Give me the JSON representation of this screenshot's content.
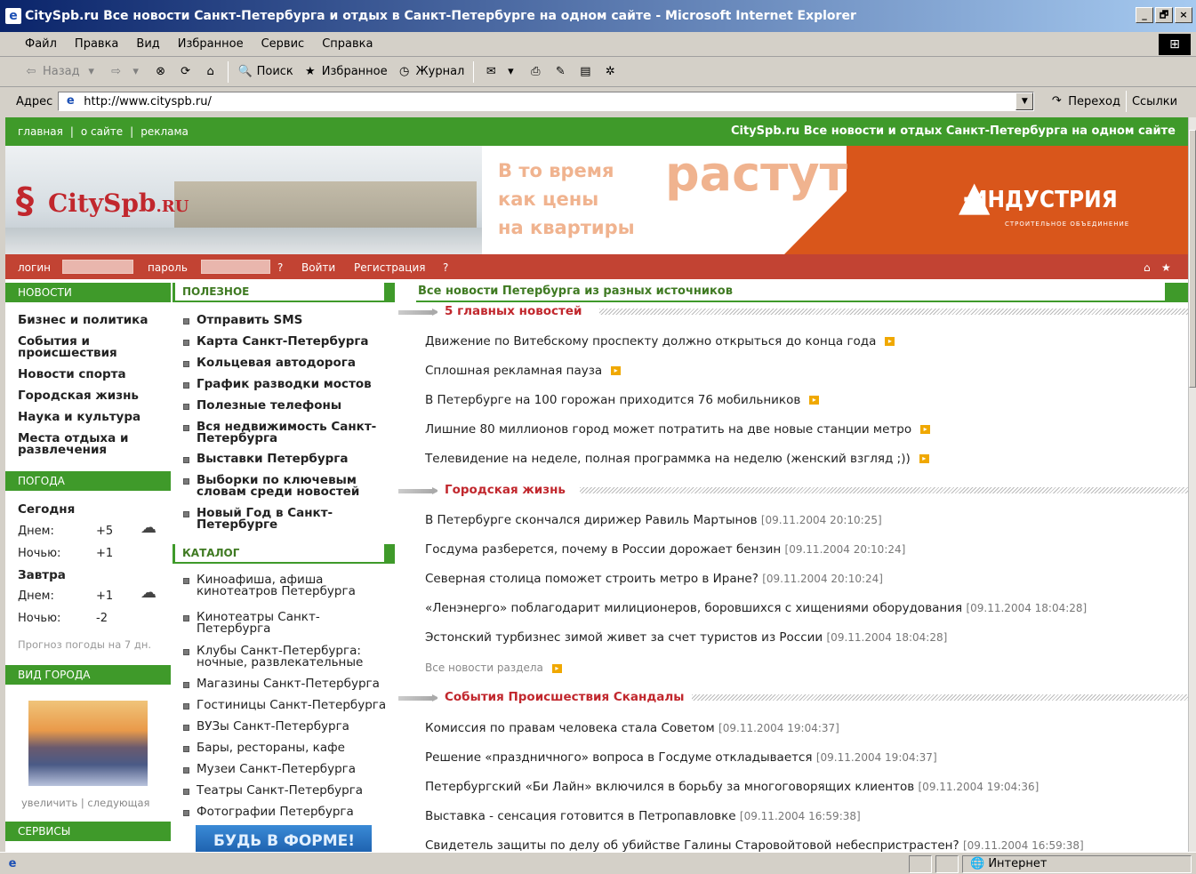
{
  "window": {
    "title": "CitySpb.ru Все новости Санкт-Петербурга и отдых в Санкт-Петербурге на одном сайте - Microsoft Internet Explorer",
    "min": "_",
    "max": "🗗",
    "close": "×"
  },
  "menu": [
    "Файл",
    "Правка",
    "Вид",
    "Избранное",
    "Сервис",
    "Справка"
  ],
  "toolbar": {
    "back": "Назад",
    "search": "Поиск",
    "favorites": "Избранное",
    "history": "Журнал"
  },
  "address": {
    "label": "Адрес",
    "url": "http://www.cityspb.ru/",
    "go": "Переход",
    "links": "Ссылки"
  },
  "site": {
    "topnav": {
      "links": [
        "главная",
        "о сайте",
        "реклама"
      ],
      "separator": "|",
      "tagline": "CitySpb.ru Все новости и отдых Санкт-Петербурга на одном сайте"
    },
    "logo": {
      "main": "CitySpb",
      "suffix": ".RU"
    },
    "ad": {
      "line1": "В то время",
      "line2": "как цены",
      "line3": "на квартиры",
      "big": "растут",
      "brand": "ИНДУСТРИЯ",
      "brand_sub": "СТРОИТЕЛЬНОЕ ОБЪЕДИНЕНИЕ"
    },
    "login": {
      "login_label": "логин",
      "password_label": "пароль",
      "q1": "?",
      "enter": "Войти",
      "register": "Регистрация",
      "q2": "?"
    },
    "left": {
      "news_head": "НОВОСТИ",
      "news_items": [
        "Бизнес и политика",
        "События и происшествия",
        "Новости спорта",
        "Городская жизнь",
        "Наука и культура",
        "Места отдыха и развлечения"
      ],
      "weather_head": "ПОГОДА",
      "today": "Сегодня",
      "tomorrow": "Завтра",
      "day": "Днем:",
      "night": "Ночью:",
      "today_day": "+5",
      "today_night": "+1",
      "tomorrow_day": "+1",
      "tomorrow_night": "-2",
      "forecast_link": "Прогноз погоды на 7 дн.",
      "city_head": "ВИД ГОРОДА",
      "enlarge": "увеличить",
      "next": "следующая",
      "services_head": "СЕРВИСЫ"
    },
    "mid": {
      "useful_head": "ПОЛЕЗНОЕ",
      "useful": [
        "Отправить SMS",
        "Карта Санкт-Петербурга",
        "Кольцевая автодорога",
        "График разводки мостов",
        "Полезные телефоны",
        "Вся недвижимость Санкт-Петербурга",
        "Выставки Петербурга",
        "Выборки по ключевым словам среди новостей",
        "Новый Год в Санкт-Петербурге"
      ],
      "catalog_head": "КАТАЛОГ",
      "catalog": [
        "Киноафиша, афиша кинотеатров Петербурга",
        "Кинотеатры Санкт-Петербурга",
        "Клубы Санкт-Петербурга: ночные, развлекательные",
        "Магазины Санкт-Петербурга",
        "Гостиницы Санкт-Петербурга",
        "ВУЗы Санкт-Петербурга",
        "Бары, рестораны, кафе",
        "Музеи Санкт-Петербурга",
        "Театры Санкт-Петербурга",
        "Фотографии Петербурга"
      ],
      "promo": "БУДЬ В ФОРМЕ!"
    },
    "main": {
      "head": "Все новости Петербурга из разных источников",
      "sec1": "5 главных новостей",
      "top5": [
        "Движение по Витебскому проспекту должно открыться до конца года",
        "Сплошная рекламная пауза",
        "В Петербурге на 100 горожан приходится 76 мобильников",
        "Лишние 80 миллионов город может потратить на две новые станции метро",
        "Телевидение на неделе, полная программка на неделю (женский взгляд ;))"
      ],
      "sec2": "Городская жизнь",
      "city": [
        {
          "t": "В Петербурге скончался дирижер Равиль Мартынов",
          "d": "[09.11.2004 20:10:25]"
        },
        {
          "t": "Госдума разберется, почему в России дорожает бензин",
          "d": "[09.11.2004 20:10:24]"
        },
        {
          "t": "Северная столица поможет строить метро в Иране?",
          "d": "[09.11.2004 20:10:24]"
        },
        {
          "t": "«Ленэнерго» поблагодарит милиционеров, боровшихся с хищениями оборудования",
          "d": "[09.11.2004 18:04:28]"
        },
        {
          "t": "Эстонский турбизнес зимой живет за счет туристов из России",
          "d": "[09.11.2004 18:04:28]"
        }
      ],
      "all_section": "Все новости раздела",
      "sec3": "События Происшествия Скандалы",
      "events": [
        {
          "t": "Комиссия по правам человека стала Советом",
          "d": "[09.11.2004 19:04:37]"
        },
        {
          "t": "Решение «праздничного» вопроса в Госдуме откладывается",
          "d": "[09.11.2004 19:04:37]"
        },
        {
          "t": "Петербургский «Би Лайн» включился в борьбу за многоговорящих клиентов",
          "d": "[09.11.2004 19:04:36]"
        },
        {
          "t": "Выставка - сенсация готовится в Петропавловке",
          "d": "[09.11.2004 16:59:38]"
        },
        {
          "t": "Свидетель защиты по делу об убийстве Галины Старовойтовой небеспристрастен?",
          "d": "[09.11.2004 16:59:38]"
        }
      ]
    }
  },
  "status": {
    "zone": "Интернет"
  },
  "colors": {
    "green": "#3f9a2a",
    "red": "#c24333",
    "headline_red": "#c1272d",
    "ad_orange": "#d9561b"
  }
}
